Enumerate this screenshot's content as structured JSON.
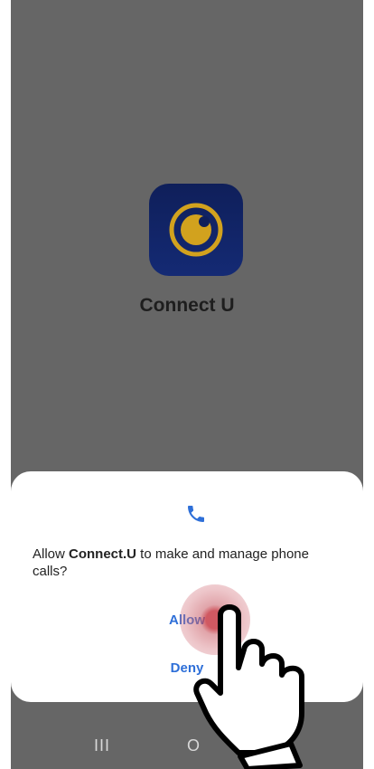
{
  "app": {
    "name": "Connect U",
    "icon": "connect-u-logo"
  },
  "dialog": {
    "icon": "phone-icon",
    "message_prefix": "Allow ",
    "app_name": "Connect.U",
    "message_suffix": " to make and manage phone calls?",
    "allow_label": "Allow",
    "deny_label": "Deny"
  },
  "navbar": {
    "recent": "III",
    "home": "O"
  },
  "colors": {
    "accent": "#2e6fd8",
    "icon_bg": "#142a74",
    "icon_ring": "#d2a21e"
  }
}
